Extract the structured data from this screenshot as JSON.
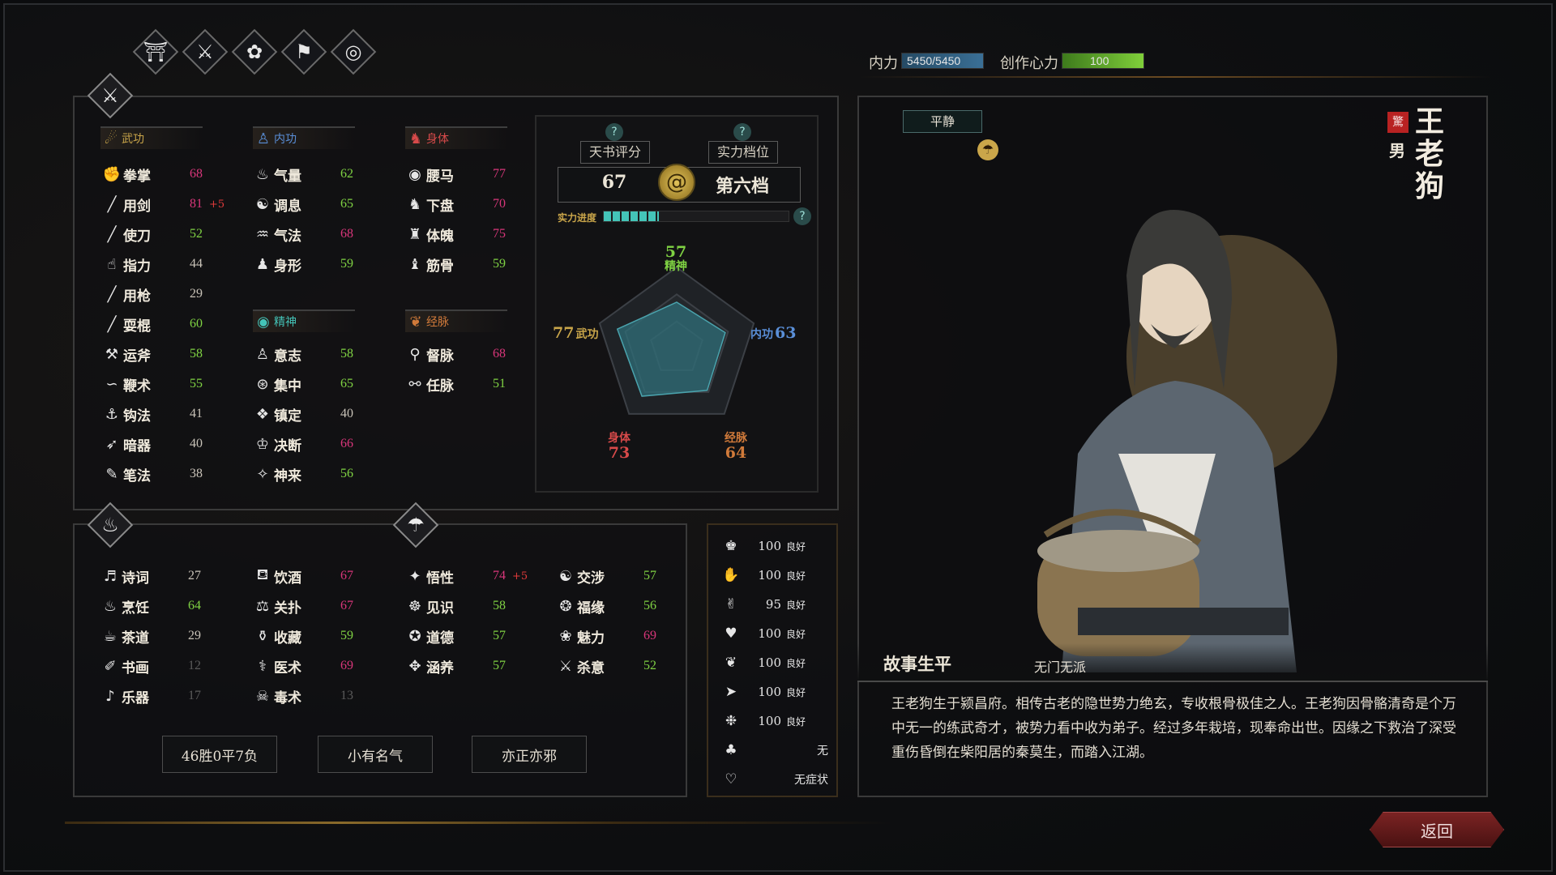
{
  "nav_icons": [
    {
      "name": "character-icon",
      "glyph": "⛩"
    },
    {
      "name": "martial-icon",
      "glyph": "⚔"
    },
    {
      "name": "relations-icon",
      "glyph": "✿"
    },
    {
      "name": "flag-icon",
      "glyph": "⚑"
    },
    {
      "name": "target-icon",
      "glyph": "◎"
    }
  ],
  "resources": {
    "neili_label": "内力",
    "neili_value": "5450/5450",
    "neili_fraction": 1.0,
    "creativity_label": "创作心力",
    "creativity_value": "100",
    "creativity_fraction": 1.0
  },
  "sections": {
    "wugong": "武功",
    "neigong": "内功",
    "shenti": "身体",
    "jingshen": "精神",
    "jingmai": "经脉"
  },
  "wugong": [
    {
      "icon": "✊",
      "name": "拳掌",
      "value": "68",
      "color": "pink"
    },
    {
      "icon": "╱",
      "name": "用剑",
      "value": "81",
      "bonus": "+5",
      "color": "pink"
    },
    {
      "icon": "╱",
      "name": "使刀",
      "value": "52",
      "color": "green"
    },
    {
      "icon": "☝",
      "name": "指力",
      "value": "44",
      "color": "grey"
    },
    {
      "icon": "╱",
      "name": "用枪",
      "value": "29",
      "color": "grey"
    },
    {
      "icon": "╱",
      "name": "耍棍",
      "value": "60",
      "color": "green"
    },
    {
      "icon": "⚒",
      "name": "运斧",
      "value": "58",
      "color": "green"
    },
    {
      "icon": "∽",
      "name": "鞭术",
      "value": "55",
      "color": "green"
    },
    {
      "icon": "⚓",
      "name": "钩法",
      "value": "41",
      "color": "grey"
    },
    {
      "icon": "➶",
      "name": "暗器",
      "value": "40",
      "color": "grey"
    },
    {
      "icon": "✎",
      "name": "笔法",
      "value": "38",
      "color": "grey"
    }
  ],
  "neigong": [
    {
      "icon": "♨",
      "name": "气量",
      "value": "62",
      "color": "green"
    },
    {
      "icon": "☯",
      "name": "调息",
      "value": "65",
      "color": "green"
    },
    {
      "icon": "♒",
      "name": "气法",
      "value": "68",
      "color": "pink"
    },
    {
      "icon": "♟",
      "name": "身形",
      "value": "59",
      "color": "green"
    }
  ],
  "shenti": [
    {
      "icon": "◉",
      "name": "腰马",
      "value": "77",
      "color": "pink"
    },
    {
      "icon": "♞",
      "name": "下盘",
      "value": "70",
      "color": "pink"
    },
    {
      "icon": "♜",
      "name": "体魄",
      "value": "75",
      "color": "pink"
    },
    {
      "icon": "♝",
      "name": "筋骨",
      "value": "59",
      "color": "green"
    }
  ],
  "jingshen": [
    {
      "icon": "♙",
      "name": "意志",
      "value": "58",
      "color": "green"
    },
    {
      "icon": "⊛",
      "name": "集中",
      "value": "65",
      "color": "green"
    },
    {
      "icon": "❖",
      "name": "镇定",
      "value": "40",
      "color": "grey"
    },
    {
      "icon": "♔",
      "name": "决断",
      "value": "66",
      "color": "pink"
    },
    {
      "icon": "✧",
      "name": "神来",
      "value": "56",
      "color": "green"
    }
  ],
  "jingmai": [
    {
      "icon": "⚲",
      "name": "督脉",
      "value": "68",
      "color": "pink"
    },
    {
      "icon": "⚯",
      "name": "任脉",
      "value": "51",
      "color": "green"
    }
  ],
  "score": {
    "tianshu_label": "天书评分",
    "tianshu_value": "67",
    "tier_label": "实力档位",
    "tier_value": "第六档",
    "progress_label": "实力进度",
    "progress_fraction": 0.3,
    "qmark": "?"
  },
  "radar": {
    "jingshen_label": "精神",
    "jingshen_value": "57",
    "neigong_label": "内功",
    "neigong_value": "63",
    "jingmai_label": "经脉",
    "jingmai_value": "64",
    "shenti_label": "身体",
    "shenti_value": "73",
    "wugong_label": "武功",
    "wugong_value": "77",
    "max": 100
  },
  "arts_col1": [
    {
      "icon": "♬",
      "name": "诗词",
      "value": "27",
      "color": "grey"
    },
    {
      "icon": "♨",
      "name": "烹饪",
      "value": "64",
      "color": "green"
    },
    {
      "icon": "☕",
      "name": "茶道",
      "value": "29",
      "color": "grey"
    },
    {
      "icon": "✐",
      "name": "书画",
      "value": "12",
      "color": "dim"
    },
    {
      "icon": "♪",
      "name": "乐器",
      "value": "17",
      "color": "dim"
    }
  ],
  "arts_col2": [
    {
      "icon": "⛾",
      "name": "饮酒",
      "value": "67",
      "color": "pink"
    },
    {
      "icon": "⚖",
      "name": "关扑",
      "value": "67",
      "color": "pink"
    },
    {
      "icon": "⚱",
      "name": "收藏",
      "value": "59",
      "color": "green"
    },
    {
      "icon": "⚕",
      "name": "医术",
      "value": "69",
      "color": "pink"
    },
    {
      "icon": "☠",
      "name": "毒术",
      "value": "13",
      "color": "dim"
    }
  ],
  "arts_col3": [
    {
      "icon": "✦",
      "name": "悟性",
      "value": "74",
      "bonus": "+5",
      "color": "pink"
    },
    {
      "icon": "☸",
      "name": "见识",
      "value": "58",
      "color": "green"
    },
    {
      "icon": "✪",
      "name": "道德",
      "value": "57",
      "color": "green"
    },
    {
      "icon": "✥",
      "name": "涵养",
      "value": "57",
      "color": "green"
    }
  ],
  "arts_col4": [
    {
      "icon": "☯",
      "name": "交涉",
      "value": "57",
      "color": "green"
    },
    {
      "icon": "❂",
      "name": "福缘",
      "value": "56",
      "color": "green"
    },
    {
      "icon": "❀",
      "name": "魅力",
      "value": "69",
      "color": "pink"
    },
    {
      "icon": "⚔",
      "name": "杀意",
      "value": "52",
      "color": "green"
    }
  ],
  "buttons": {
    "record": "46胜0平7负",
    "fame": "小有名气",
    "alignment": "亦正亦邪"
  },
  "status_list": [
    {
      "icon": "♚",
      "value": "100",
      "quality": "良好"
    },
    {
      "icon": "✋",
      "value": "100",
      "quality": "良好"
    },
    {
      "icon": "✌",
      "value": "95",
      "quality": "良好"
    },
    {
      "icon": "♥",
      "value": "100",
      "quality": "良好"
    },
    {
      "icon": "❦",
      "value": "100",
      "quality": "良好"
    },
    {
      "icon": "➤",
      "value": "100",
      "quality": "良好"
    },
    {
      "icon": "❉",
      "value": "100",
      "quality": "良好"
    }
  ],
  "status_extra": [
    {
      "icon": "♣",
      "text": "无"
    },
    {
      "icon": "♡",
      "text": "无症状"
    }
  ],
  "character": {
    "mood": "平静",
    "seal": "驚",
    "gender": "男",
    "name": "王老狗",
    "story_title": "故事生平",
    "faction": "无门无派",
    "story": "王老狗生于颍昌府。相传古老的隐世势力绝玄，专收根骨极佳之人。王老狗因骨骼清奇是个万中无一的练武奇才，被势力看中收为弟子。经过多年栽培，现奉命出世。因缘之下救治了深受重伤昏倒在柴阳居的秦莫生，而踏入江湖。"
  },
  "back_button": "返回",
  "colors": {
    "pink": "#d8367a",
    "green": "#7fd243",
    "teal": "#44c4b8",
    "gold": "#caa64a"
  }
}
